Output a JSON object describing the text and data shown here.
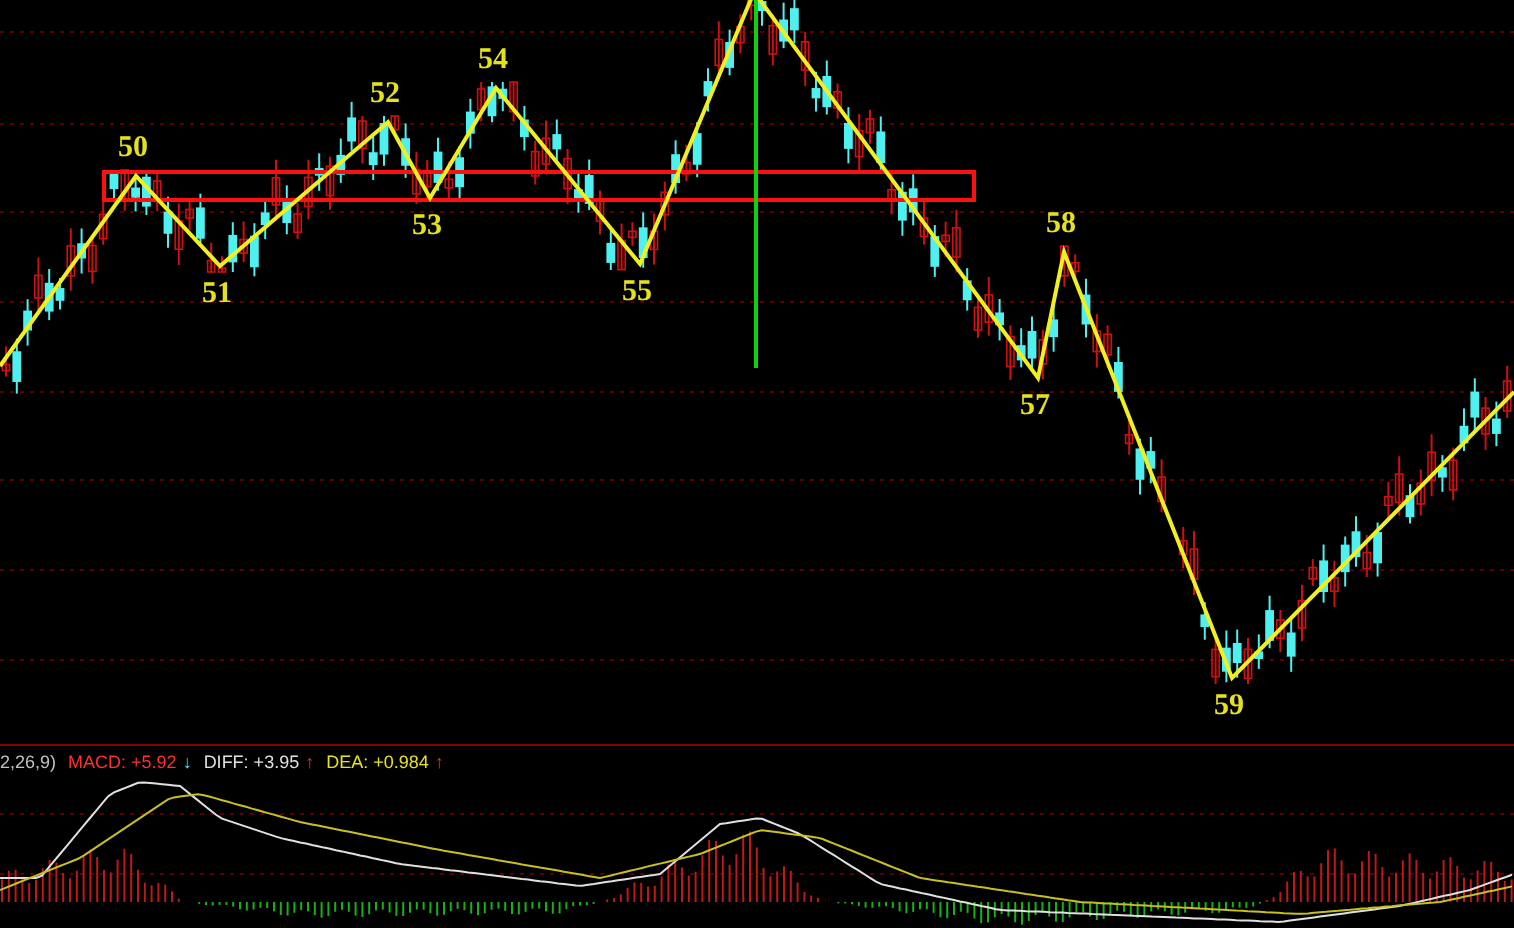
{
  "chart": {
    "waves": [
      {
        "label": "50",
        "kind": "peak"
      },
      {
        "label": "51",
        "kind": "trough"
      },
      {
        "label": "52",
        "kind": "peak"
      },
      {
        "label": "53",
        "kind": "trough"
      },
      {
        "label": "54",
        "kind": "peak"
      },
      {
        "label": "55",
        "kind": "trough"
      },
      {
        "label": "57",
        "kind": "trough"
      },
      {
        "label": "58",
        "kind": "peak"
      },
      {
        "label": "59",
        "kind": "trough"
      }
    ]
  },
  "macd_panel": {
    "legend": [
      {
        "text": "2,26,9)",
        "kind": "params"
      },
      {
        "text": "MACD: +5.92",
        "kind": "macd",
        "arrow": "↓"
      },
      {
        "text": "DIFF: +3.95",
        "kind": "diff",
        "arrow": "↑"
      },
      {
        "text": "DEA: +0.984",
        "kind": "dea",
        "arrow": "↑"
      }
    ]
  }
}
